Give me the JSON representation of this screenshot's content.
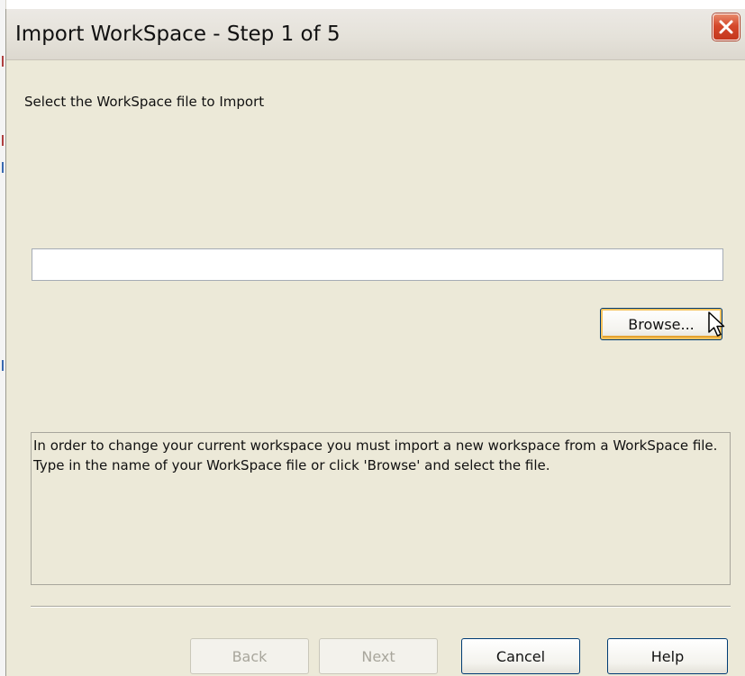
{
  "dialog": {
    "title": "Import WorkSpace - Step 1 of 5",
    "instruction": "Select the WorkSpace file to Import",
    "file_path": "",
    "browse_label": "Browse...",
    "description": "In order to change your current workspace you must import a new workspace from a WorkSpace file. Type in the name of your WorkSpace file or click 'Browse' and select the file.",
    "buttons": {
      "back": "Back",
      "next": "Next",
      "cancel": "Cancel",
      "help": "Help"
    }
  },
  "icons": {
    "close": "close-icon",
    "cursor": "mouse-pointer-icon"
  },
  "colors": {
    "dialog_background": "#ece9d8",
    "close_button": "#d5482b",
    "button_border": "#003c74",
    "focus_highlight": "#f5c35e"
  }
}
